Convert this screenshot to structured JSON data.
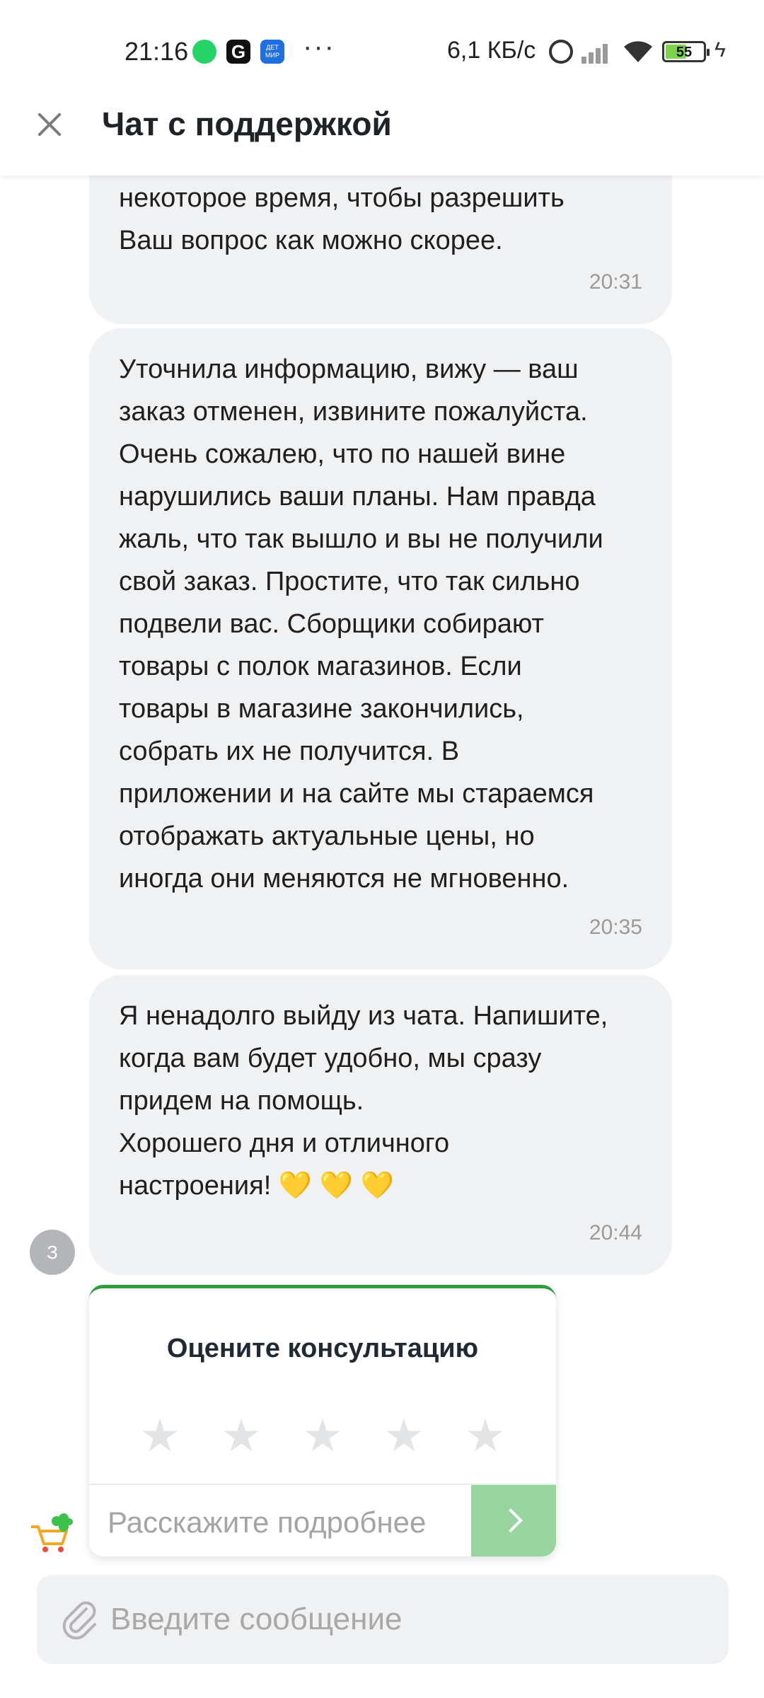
{
  "status_bar": {
    "time": "21:16",
    "app_g": "G",
    "app_dm": "ДЕТ\nМИР",
    "more": "···",
    "speed": "6,1 КБ/с",
    "battery": "55",
    "charging": "ϟ"
  },
  "header": {
    "title": "Чат с поддержкой"
  },
  "messages": [
    {
      "text": "некоторое время, чтобы разрешить\nВаш вопрос как можно скорее.",
      "time": "20:31"
    },
    {
      "text": "Уточнила информацию, вижу — ваш\nзаказ отменен, извините пожалуйста.\nОчень сожалею, что по нашей вине\nнарушились ваши планы. Нам правда\nжаль, что так вышло и вы не получили\nсвой заказ. Простите, что так сильно\nподвели вас. Сборщики собирают\nтовары с полок магазинов. Если\nтовары в магазине закончились,\nсобрать их не получится. В\nприложении и на сайте мы стараемся\nотображать актуальные цены, но\nиногда они меняются не мгновенно.",
      "time": "20:35"
    },
    {
      "text": "Я ненадолго выйду из чата. Напишите,\nкогда вам будет удобно, мы сразу\nпридем на помощь.\nХорошего дня и отличного\nнастроения! 💛 💛 💛",
      "time": "20:44"
    }
  ],
  "operator_avatar": {
    "label": "З"
  },
  "rating": {
    "title": "Оцените консультацию",
    "star_glyph": "★",
    "stars_max": 5,
    "stars_selected": 0,
    "feedback_placeholder": "Расскажите подробнее"
  },
  "composer": {
    "placeholder": "Введите сообщение"
  },
  "colors": {
    "accent": "#2e9d3a",
    "send_button": "#99d59f",
    "bubble": "#f0f1f3",
    "star_inactive": "#e3e4e6"
  },
  "icons": {
    "close": "close-icon",
    "send": "chevron-right-icon",
    "attach": "paperclip-icon",
    "cart": "shopping-cart-icon"
  }
}
